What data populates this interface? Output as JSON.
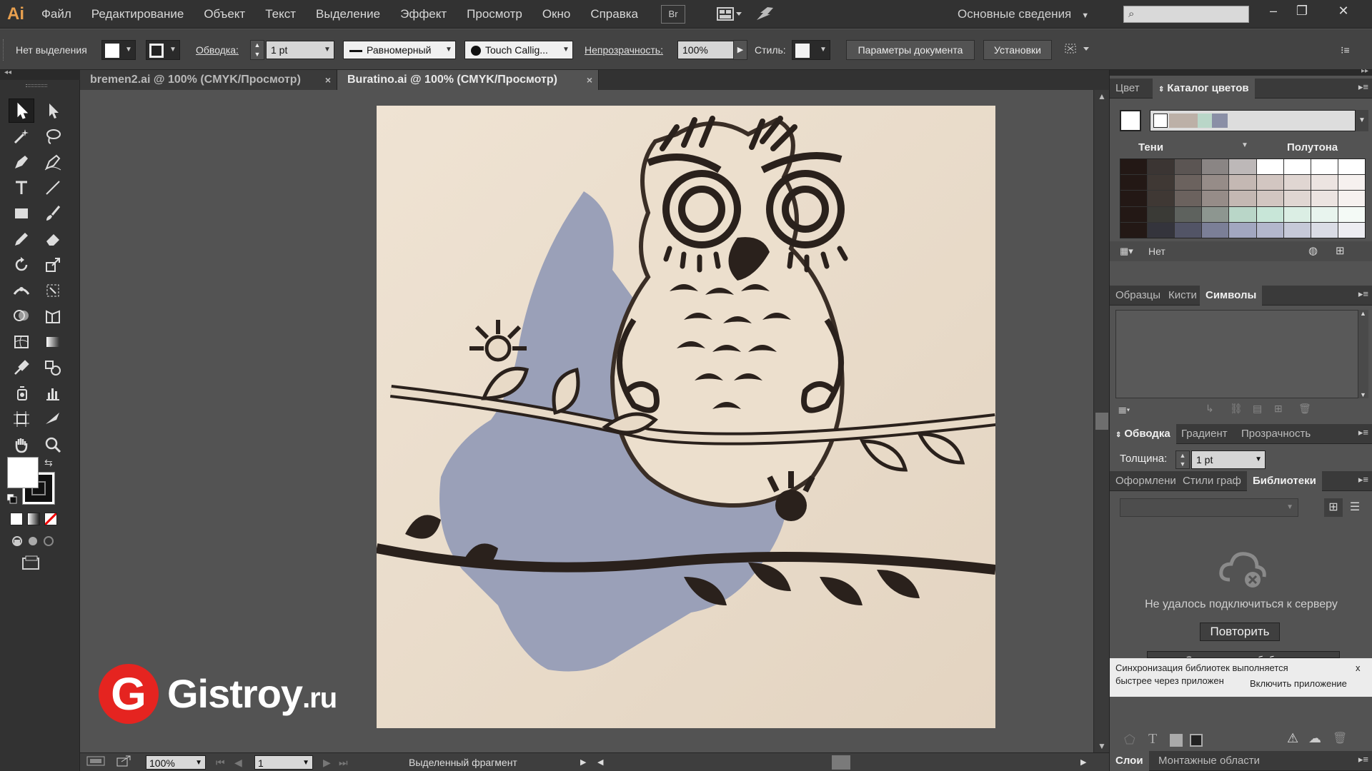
{
  "app": {
    "logo": "Ai",
    "menus": [
      "Файл",
      "Редактирование",
      "Объект",
      "Текст",
      "Выделение",
      "Эффект",
      "Просмотр",
      "Окно",
      "Справка"
    ],
    "bridge_label": "Br",
    "workspace": "Основные сведения",
    "search_value": "",
    "window_buttons": [
      "–",
      "❐",
      "✕"
    ]
  },
  "control": {
    "selection": "Нет выделения",
    "stroke_label": "Обводка:",
    "stroke_value": "1 pt",
    "profile": "Равномерный",
    "brush": "Touch Callig...",
    "opacity_label": "Непрозрачность:",
    "opacity_value": "100%",
    "style_label": "Стиль:",
    "doc_settings": "Параметры документа",
    "preferences": "Установки"
  },
  "tabs": [
    {
      "label": "bremen2.ai @ 100% (CMYK/Просмотр)",
      "close": "×"
    },
    {
      "label": "Buratino.ai @ 100% (CMYK/Просмотр)",
      "close": "×"
    }
  ],
  "panels": {
    "color": {
      "tabs": [
        "Цвет",
        "Каталог цветов"
      ],
      "shades_label": "Тени",
      "tints_label": "Полутона",
      "none_label": "Нет",
      "grid_colors": [
        "#231815",
        "#3b3533",
        "#5b5553",
        "#8a8584",
        "#bdb8b8",
        "#ffffff",
        "#ffffff",
        "#ffffff",
        "#ffffff",
        "#231815",
        "#3f3834",
        "#6b625e",
        "#968c88",
        "#c4b8b3",
        "#d2c6c1",
        "#e0d6d2",
        "#ece4e1",
        "#f6f1ef",
        "#231815",
        "#3f3834",
        "#6b625e",
        "#968c88",
        "#c4b8b3",
        "#d2c6c1",
        "#e0d6d2",
        "#ece4e1",
        "#f6f1ef",
        "#231815",
        "#3a3a36",
        "#5e625e",
        "#8d9690",
        "#b9d6c8",
        "#c8e6d8",
        "#dbeee4",
        "#e8f4ee",
        "#f4faf6",
        "#231815",
        "#34343c",
        "#525466",
        "#7b7f97",
        "#a2a7c0",
        "#b3b7cc",
        "#c6c9d8",
        "#dadce5",
        "#ededf2"
      ]
    },
    "swatches": {
      "tabs": [
        "Образцы",
        "Кисти",
        "Символы"
      ]
    },
    "stroke": {
      "tabs": [
        "Обводка",
        "Градиент",
        "Прозрачность"
      ],
      "weight_label": "Толщина:",
      "weight_value": "1 pt"
    },
    "libraries": {
      "tabs": [
        "Оформлени",
        "Стили граф",
        "Библиотеки"
      ],
      "error_text": "Не удалось подключиться к серверу",
      "retry": "Повторить",
      "create_library": "+ Создать новую библиотеку",
      "sync_text_1": "Синхронизация библиотек выполняется",
      "sync_text_2": "быстрее через приложен",
      "enable_app": "Включить приложение",
      "close": "x"
    },
    "layers": {
      "tabs": [
        "Слои",
        "Монтажные области"
      ]
    }
  },
  "status": {
    "zoom": "100%",
    "page": "1",
    "info": "Выделенный фрагмент"
  },
  "watermark": {
    "mark": "G",
    "name": "Gistroy",
    "suffix": ".ru"
  },
  "colors": {
    "artboard_wood": "#e9dccb",
    "shadow_blue": "#9aa0b8",
    "cut_dark": "#2a211c",
    "accent_orange": "#e49b6a",
    "brand_red": "#e52420"
  }
}
